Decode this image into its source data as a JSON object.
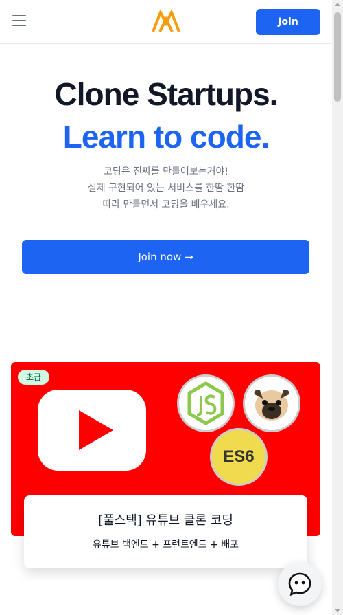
{
  "header": {
    "join_label": "Join",
    "menu_icon": "hamburger-menu-icon",
    "logo_icon": "nomad-logo-icon",
    "logo_color": "#f59e0b"
  },
  "hero": {
    "title_line1": "Clone Startups.",
    "title_line2": "Learn to code.",
    "subtitle_lines": [
      "코딩은 진짜를 만들어보는거야!",
      "실제 구현되어 있는 서비스를 한땀 한땀",
      "따라 만들면서 코딩을 배우세요."
    ],
    "cta_label": "Join now →",
    "accent_color": "#1d64f2"
  },
  "course": {
    "level_badge": "초급",
    "es6_label": "ES6",
    "card_color": "#ff0000",
    "title": "[풀스택] 유튜브 클론 코딩",
    "description": "유튜브 백엔드 + 프런트엔드 + 배포",
    "icons": [
      "youtube-logo-icon",
      "nodejs-icon",
      "pug-icon",
      "es6-icon"
    ]
  },
  "chat": {
    "icon": "chat-bubble-icon"
  }
}
